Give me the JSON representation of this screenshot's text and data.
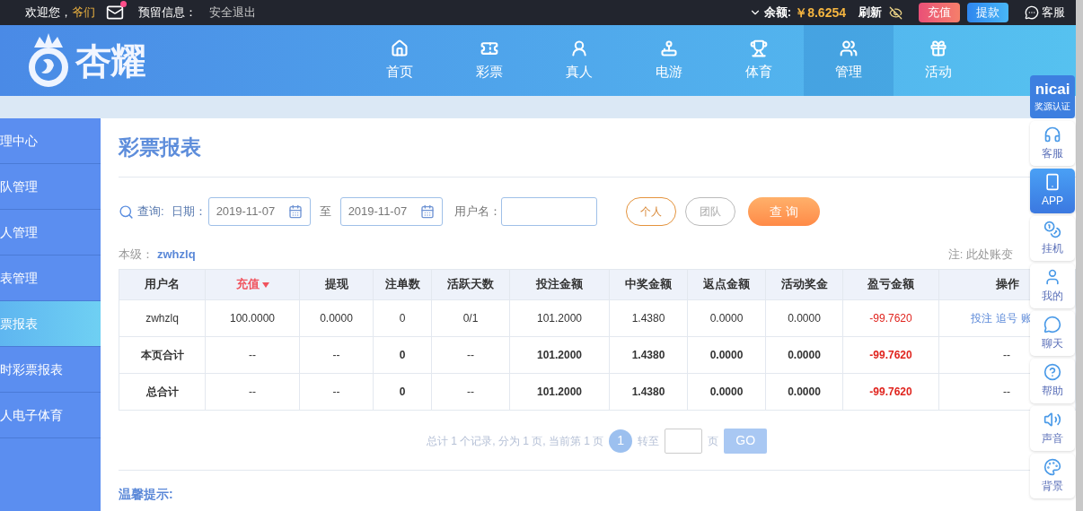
{
  "top_bar": {
    "welcome": "欢迎您，",
    "username": "爷们",
    "mail_unread": true,
    "reserved_info": "预留信息：",
    "logout": "安全退出",
    "balance_label": "余额:",
    "balance": "￥8.6254",
    "refresh": "刷新",
    "deposit": "充值",
    "withdraw": "提款",
    "service": "客服"
  },
  "header": {
    "logo_text": "杏耀",
    "nav": [
      {
        "label": "首页",
        "selected": false
      },
      {
        "label": "彩票",
        "selected": false
      },
      {
        "label": "真人",
        "selected": false
      },
      {
        "label": "电游",
        "selected": false
      },
      {
        "label": "体育",
        "selected": false
      },
      {
        "label": "管理",
        "selected": true
      },
      {
        "label": "活动",
        "selected": false
      }
    ]
  },
  "sidebar": {
    "items": [
      {
        "label": "理中心",
        "selected": false
      },
      {
        "label": "队管理",
        "selected": false
      },
      {
        "label": "人管理",
        "selected": false
      },
      {
        "label": "表管理",
        "selected": false
      },
      {
        "label": "票报表",
        "selected": true
      },
      {
        "label": "时彩票报表",
        "selected": false
      },
      {
        "label": "人电子体育",
        "selected": false
      }
    ]
  },
  "page": {
    "title": "彩票报表",
    "query": {
      "label": "查询:",
      "date_label": "日期：",
      "date_from": "2019-11-07",
      "to": "至",
      "date_to": "2019-11-07",
      "user_label": "用户名：",
      "scopes": [
        {
          "label": "个人",
          "selected": true
        },
        {
          "label": "团队",
          "selected": false
        }
      ],
      "submit": "查 询"
    },
    "level_label": "本级：",
    "level_user": "zwhzlq",
    "note": "注: 此处账变",
    "table": {
      "columns": [
        {
          "label": "用户名",
          "sorted": false
        },
        {
          "label": "充值",
          "sorted": true
        },
        {
          "label": "提现",
          "sorted": false
        },
        {
          "label": "注单数",
          "sorted": false
        },
        {
          "label": "活跃天数",
          "sorted": false
        },
        {
          "label": "投注金额",
          "sorted": false
        },
        {
          "label": "中奖金额",
          "sorted": false
        },
        {
          "label": "返点金额",
          "sorted": false
        },
        {
          "label": "活动奖金",
          "sorted": false
        },
        {
          "label": "盈亏金额",
          "sorted": false
        },
        {
          "label": "操作",
          "sorted": false
        }
      ],
      "rows": [
        {
          "kind": "data",
          "cells": [
            "zwhzlq",
            "100.0000",
            "0.0000",
            "0",
            "0/1",
            "101.2000",
            "1.4380",
            "0.0000",
            "0.0000",
            "-99.7620"
          ],
          "actions": [
            "投注",
            "追号",
            "账"
          ]
        },
        {
          "kind": "total",
          "cells": [
            "本页合计",
            "--",
            "--",
            "0",
            "--",
            "101.2000",
            "1.4380",
            "0.0000",
            "0.0000",
            "-99.7620"
          ],
          "actions_text": "--"
        },
        {
          "kind": "total",
          "cells": [
            "总合计",
            "--",
            "--",
            "0",
            "--",
            "101.2000",
            "1.4380",
            "0.0000",
            "0.0000",
            "-99.7620"
          ],
          "actions_text": "--"
        }
      ]
    },
    "pagination": {
      "summary": "总计 1 个记录, 分为 1 页, 当前第 1 页",
      "pages": [
        {
          "label": "1",
          "selected": true
        }
      ],
      "goto": "转至",
      "page_unit": "页",
      "go": "GO"
    },
    "tips_title": "温馨提示:"
  },
  "float_panel": {
    "badge_logo": "nicai",
    "badge_caption": "奖源认证",
    "items": [
      {
        "label": "客服",
        "selected": false
      },
      {
        "label": "APP",
        "selected": true
      },
      {
        "label": "挂机",
        "selected": false
      },
      {
        "label": "我的",
        "selected": false
      },
      {
        "label": "聊天",
        "selected": false
      },
      {
        "label": "帮助",
        "selected": false
      },
      {
        "label": "声音",
        "selected": false
      },
      {
        "label": "背景",
        "selected": false
      }
    ]
  }
}
